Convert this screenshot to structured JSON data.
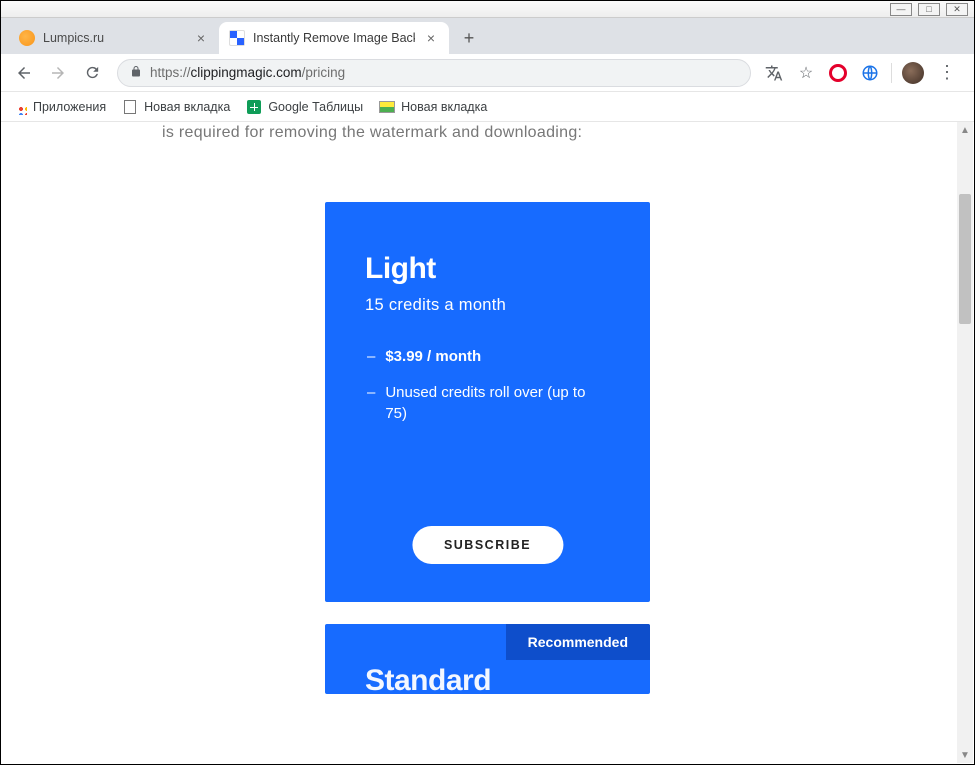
{
  "window": {
    "min": "—",
    "max": "□",
    "close": "✕"
  },
  "tabs": [
    {
      "label": "Lumpics.ru",
      "active": false
    },
    {
      "label": "Instantly Remove Image Backgro",
      "active": true
    }
  ],
  "address": {
    "scheme": "https://",
    "host": "clippingmagic.com",
    "path": "/pricing"
  },
  "bookmarks": [
    {
      "label": "Приложения",
      "icon": "apps"
    },
    {
      "label": "Новая вкладка",
      "icon": "doc"
    },
    {
      "label": "Google Таблицы",
      "icon": "sheets"
    },
    {
      "label": "Новая вкладка",
      "icon": "pic"
    }
  ],
  "page": {
    "lead": "is required for removing the watermark and downloading:",
    "plan1": {
      "name": "Light",
      "subtitle": "15 credits a month",
      "price": "$3.99 / month",
      "rollover": "Unused credits roll over (up to 75)",
      "cta": "SUBSCRIBE"
    },
    "plan2": {
      "name": "Standard",
      "badge": "Recommended"
    }
  }
}
